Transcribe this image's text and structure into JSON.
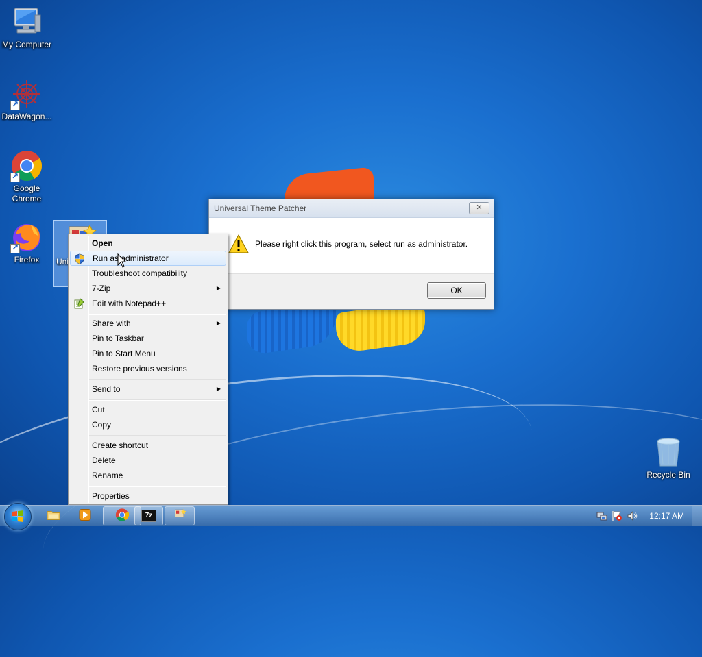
{
  "desktop": {
    "icons": [
      {
        "label": "My Computer",
        "icon": "computer-icon"
      },
      {
        "label": "DataWagon...",
        "icon": "datawagon-icon"
      },
      {
        "label": "Google Chrome",
        "icon": "chrome-icon"
      },
      {
        "label": "Firefox",
        "icon": "firefox-icon"
      },
      {
        "label": "Uni me",
        "icon": "theme-patcher-icon"
      },
      {
        "label": "Recycle Bin",
        "icon": "recycle-bin-icon"
      }
    ]
  },
  "dialog": {
    "title": "Universal Theme Patcher",
    "close_glyph": "✕",
    "message": "Please right click this program, select run as administrator.",
    "ok_label": "OK",
    "icon": "warning-icon"
  },
  "context_menu": {
    "items": [
      {
        "label": "Open"
      },
      {
        "label": "Run as administrator",
        "icon": "uac-shield-icon"
      },
      {
        "label": "Troubleshoot compatibility"
      },
      {
        "label": "7-Zip",
        "submenu": "▶"
      },
      {
        "label": "Edit with Notepad++",
        "icon": "notepad-plus-plus-icon"
      },
      {
        "label": "Share with",
        "submenu": "▶"
      },
      {
        "label": "Pin to Taskbar"
      },
      {
        "label": "Pin to Start Menu"
      },
      {
        "label": "Restore previous versions"
      },
      {
        "label": "Send to",
        "submenu": "▶"
      },
      {
        "label": "Cut"
      },
      {
        "label": "Copy"
      },
      {
        "label": "Create shortcut"
      },
      {
        "label": "Delete"
      },
      {
        "label": "Rename"
      },
      {
        "label": "Properties"
      }
    ]
  },
  "taskbar": {
    "pinned": [
      "file-explorer-icon",
      "media-player-icon",
      "chrome-icon",
      "7zip-icon",
      "theme-patcher-icon"
    ],
    "seven_zip_label": "7z",
    "clock": "12:17 AM"
  },
  "colors": {
    "accent_blue": "#1a6fcf",
    "menu_highlight_border": "#aecff7"
  }
}
